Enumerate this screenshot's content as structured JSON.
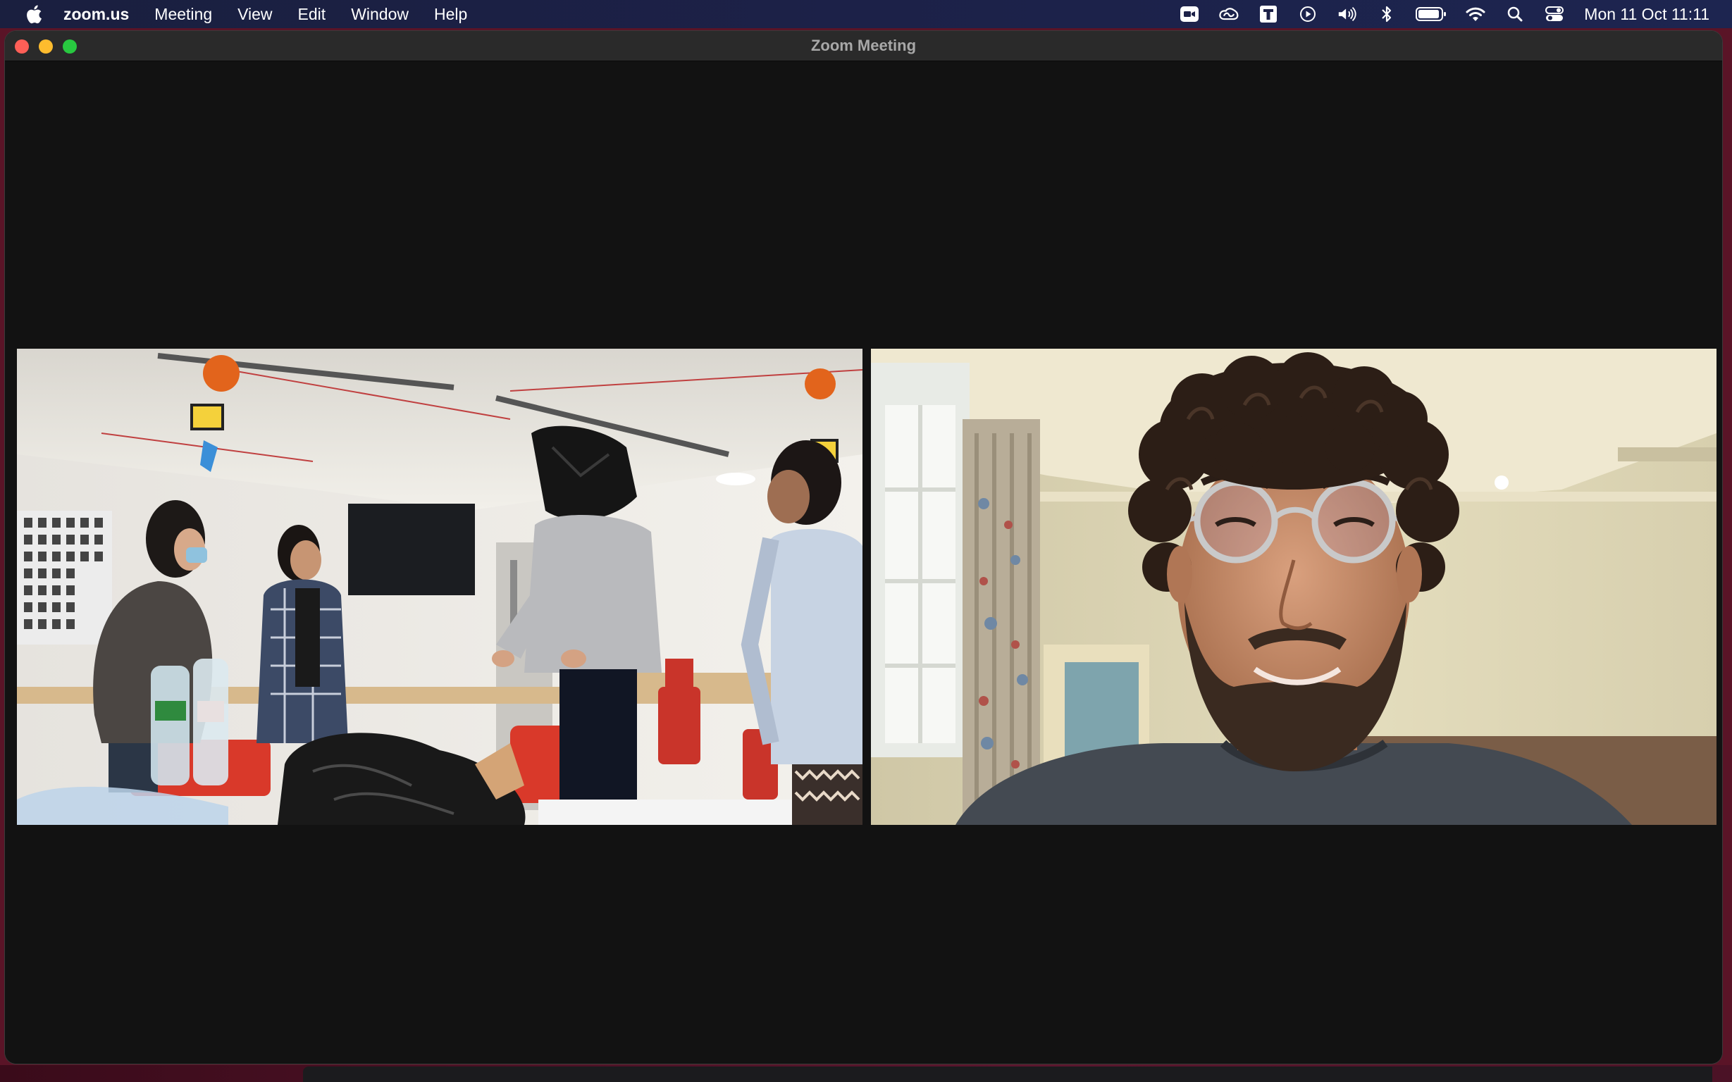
{
  "menubar": {
    "apple_icon": "apple-logo-icon",
    "app_name": "zoom.us",
    "menus": [
      "Meeting",
      "View",
      "Edit",
      "Window",
      "Help"
    ],
    "status_icons": [
      "zoom-camera-icon",
      "creative-cloud-icon",
      "text-t-icon",
      "play-circle-icon",
      "volume-icon",
      "bluetooth-icon",
      "battery-icon",
      "wifi-icon",
      "search-icon",
      "control-center-icon"
    ],
    "clock": "Mon 11 Oct  11:11"
  },
  "window": {
    "title": "Zoom Meeting"
  },
  "participants": [
    {
      "tile": "video-tile-group",
      "scene": "workshop room with four people, one wearing a black bag over the head"
    },
    {
      "tile": "video-tile-man",
      "scene": "curly-haired man with glasses smiling in a room with curtains"
    }
  ],
  "colors": {
    "menubar": "#1c2148",
    "window_bg": "#121212",
    "titlebar": "#2a2a2a",
    "traffic_close": "#fe5f57",
    "traffic_min": "#febc2e",
    "traffic_max": "#28c840",
    "desktop": "#5a1427"
  }
}
